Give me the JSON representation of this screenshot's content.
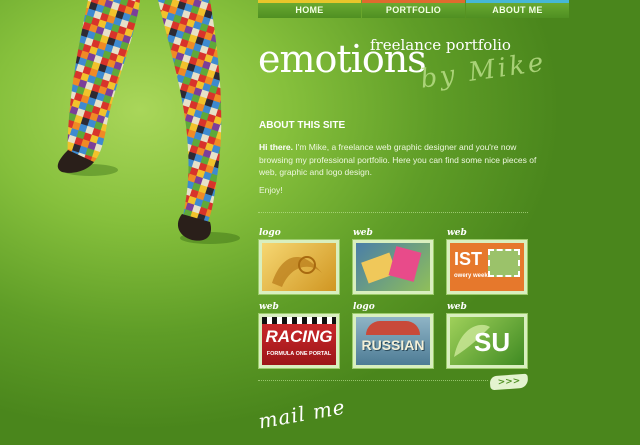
{
  "nav": {
    "home": "HOME",
    "portfolio": "PORTFOLIO",
    "about": "ABOUT ME"
  },
  "header": {
    "title": "emotions",
    "subtitle": "freelance portfolio",
    "byline": "by Mike"
  },
  "about": {
    "heading": "ABOUT THIS SITE",
    "intro_bold": "Hi there.",
    "intro_text": " I'm Mike, a freelance web graphic designer and you're now browsing my professional portfolio. Here you can find some nice pieces of web, graphic and logo design.",
    "enjoy": "Enjoy!"
  },
  "portfolio": [
    {
      "label": "logo",
      "bg": "#e9b43a"
    },
    {
      "label": "web",
      "bg": "#5d8fb8"
    },
    {
      "label": "web",
      "bg": "#e5742a",
      "text": "IST",
      "subtext": "owery week"
    },
    {
      "label": "web",
      "bg": "#c8242a",
      "text": "RACING",
      "subtext": "FORMULA ONE PORTAL"
    },
    {
      "label": "logo",
      "bg": "#7aa3b8",
      "text": "RUSSIAN"
    },
    {
      "label": "web",
      "bg": "#4f9a2d",
      "text": "SU"
    }
  ],
  "more": ">>>",
  "mail": "mail me"
}
